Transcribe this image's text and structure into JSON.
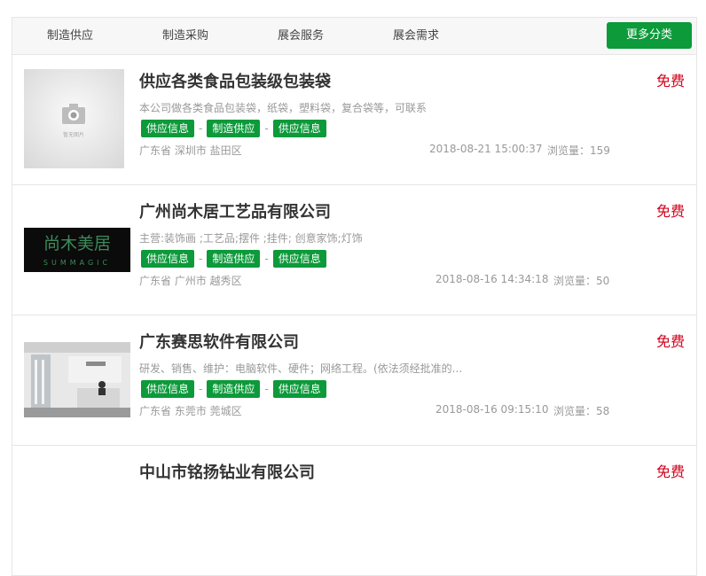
{
  "nav": {
    "tabs": [
      "制造供应",
      "制造采购",
      "展会服务",
      "展会需求"
    ],
    "more_label": "更多分类"
  },
  "colors": {
    "accent": "#0c9a3a",
    "price": "#d0021b"
  },
  "listings": [
    {
      "title": "供应各类食品包装级包装袋",
      "price": "免费",
      "desc": "本公司做各类食品包装袋，纸袋，塑料袋，复合袋等，可联系",
      "tags": [
        "供应信息",
        "制造供应",
        "供应信息"
      ],
      "location": "广东省 深圳市 盐田区",
      "time": "2018-08-21 15:00:37",
      "views": "浏览量：159",
      "image": "camera-placeholder",
      "image_caption": "暂无图片"
    },
    {
      "title": "广州尚木居工艺品有限公司",
      "price": "免费",
      "desc": "主营:装饰画 ;工艺品;摆件 ;挂件; 创意家饰;灯饰",
      "tags": [
        "供应信息",
        "制造供应",
        "供应信息"
      ],
      "location": "广东省 广州市 越秀区",
      "time": "2018-08-16 14:34:18",
      "views": "浏览量：50",
      "image": "brand-logo",
      "logo_cn": "尚木美居",
      "logo_en": "SUMMAGIC"
    },
    {
      "title": "广东赛思软件有限公司",
      "price": "免费",
      "desc": "研发、销售、维护：电脑软件、硬件；网络工程。(依法须经批准的...",
      "tags": [
        "供应信息",
        "制造供应",
        "供应信息"
      ],
      "location": "广东省 东莞市 莞城区",
      "time": "2018-08-16 09:15:10",
      "views": "浏览量：58",
      "image": "office-photo"
    },
    {
      "title": "中山市铭扬钻业有限公司",
      "price": "免费"
    }
  ]
}
